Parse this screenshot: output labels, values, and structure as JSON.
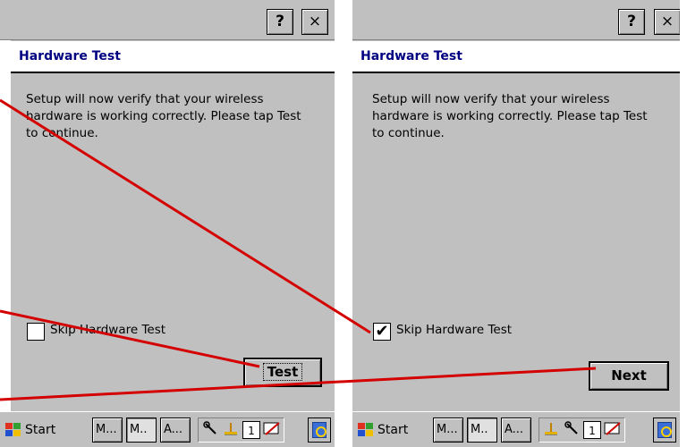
{
  "screens": [
    {
      "titlebar": {
        "help_label": "?",
        "close_label": "×"
      },
      "heading": "Hardware Test",
      "body": "Setup will now verify that your wireless hardware is working correctly. Please tap Test to continue.",
      "checkbox": {
        "label": "Skip Hardware Test",
        "checked": false,
        "mark": ""
      },
      "action_button": "Test",
      "taskbar": {
        "start_label": "Start",
        "tasks": [
          "M...",
          "M..",
          "A..."
        ],
        "tray_icons": [
          "tool-icon",
          "network-icon",
          "input-1-icon",
          "no-connection-icon"
        ],
        "tray_text": "1"
      }
    },
    {
      "titlebar": {
        "help_label": "?",
        "close_label": "×"
      },
      "heading": "Hardware Test",
      "body": "Setup will now verify that your wireless hardware is working correctly. Please tap Test to continue.",
      "checkbox": {
        "label": "Skip Hardware Test",
        "checked": true,
        "mark": "✔"
      },
      "action_button": "Next",
      "taskbar": {
        "start_label": "Start",
        "tasks": [
          "M...",
          "M..",
          "A..."
        ],
        "tray_icons": [
          "network-icon",
          "tool-icon",
          "input-1-icon",
          "no-connection-icon"
        ],
        "tray_text": "1"
      }
    }
  ],
  "colors": {
    "heading": "#000080",
    "annotation_line": "#d40000",
    "window_bg": "#c0c0c0"
  }
}
